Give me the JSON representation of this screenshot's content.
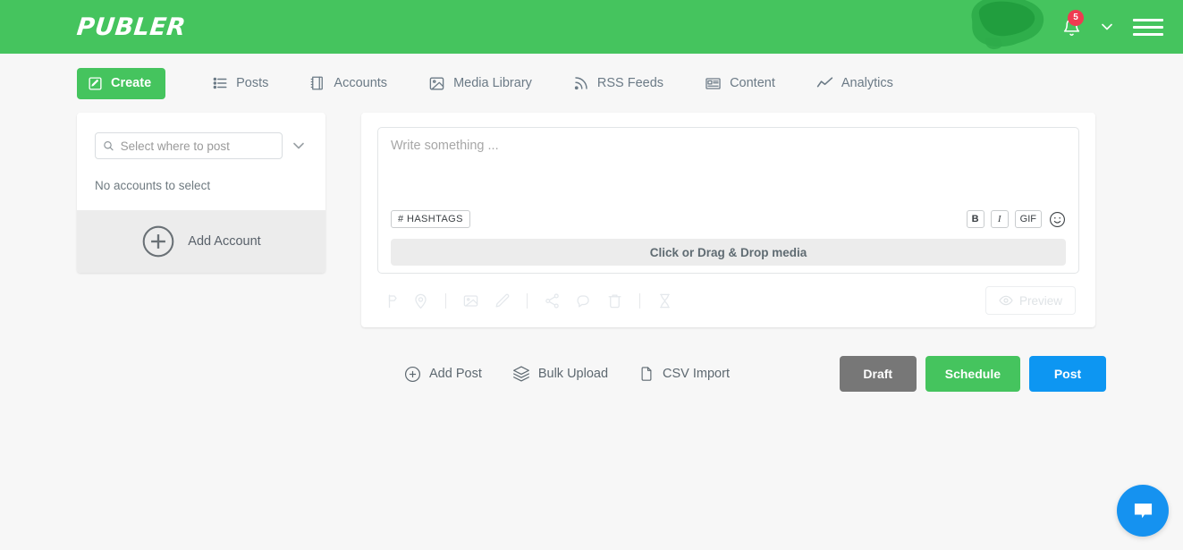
{
  "header": {
    "brand": "PUBLER",
    "notification_count": "5",
    "bell_icon": "bell-icon",
    "chevron_icon": "chevron-down-icon",
    "menu_icon": "hamburger-menu-icon",
    "accent_green": "#45c45e",
    "badge_red": "#ef3b51"
  },
  "nav": {
    "items": [
      {
        "label": "Create",
        "icon": "compose-icon",
        "active": true
      },
      {
        "label": "Posts",
        "icon": "list-icon",
        "active": false
      },
      {
        "label": "Accounts",
        "icon": "book-icon",
        "active": false
      },
      {
        "label": "Media Library",
        "icon": "image-icon",
        "active": false
      },
      {
        "label": "RSS Feeds",
        "icon": "rss-icon",
        "active": false
      },
      {
        "label": "Content",
        "icon": "newspaper-icon",
        "active": false
      },
      {
        "label": "Analytics",
        "icon": "chart-line-icon",
        "active": false
      }
    ]
  },
  "sidebar": {
    "search_placeholder": "Select where to post",
    "search_value": "",
    "search_icon": "search-icon",
    "dropdown_icon": "chevron-down-icon",
    "empty_message": "No accounts to select",
    "add_account_label": "Add Account",
    "add_account_icon": "plus-circle-icon"
  },
  "composer": {
    "editor_placeholder": "Write something ...",
    "hashtags_label": "# HASHTAGS",
    "bold_label": "B",
    "italic_label": "I",
    "gif_label": "GIF",
    "emoji_icon": "smiley-icon",
    "dropzone_label": "Click or Drag & Drop media",
    "preview_label": "Preview",
    "preview_icon": "eye-icon",
    "tools": [
      {
        "icon": "signpost-icon",
        "type": "icon"
      },
      {
        "icon": "location-pin-icon",
        "type": "icon"
      },
      {
        "icon": "divider",
        "type": "divider"
      },
      {
        "icon": "image-icon",
        "type": "icon"
      },
      {
        "icon": "pencil-icon",
        "type": "icon"
      },
      {
        "icon": "divider",
        "type": "divider"
      },
      {
        "icon": "share-icon",
        "type": "icon"
      },
      {
        "icon": "comment-icon",
        "type": "icon"
      },
      {
        "icon": "trash-icon",
        "type": "icon"
      },
      {
        "icon": "divider",
        "type": "divider"
      },
      {
        "icon": "hourglass-icon",
        "type": "icon"
      }
    ]
  },
  "actions": {
    "add_post_label": "Add Post",
    "add_post_icon": "plus-circle-icon",
    "bulk_upload_label": "Bulk Upload",
    "bulk_upload_icon": "layers-icon",
    "csv_import_label": "CSV Import",
    "csv_import_icon": "file-icon",
    "draft_label": "Draft",
    "schedule_label": "Schedule",
    "post_label": "Post",
    "draft_color": "#777777",
    "schedule_color": "#45c45e",
    "post_color": "#0d96f2"
  },
  "chat": {
    "icon": "chat-bubble-icon",
    "color": "#1592f0"
  }
}
